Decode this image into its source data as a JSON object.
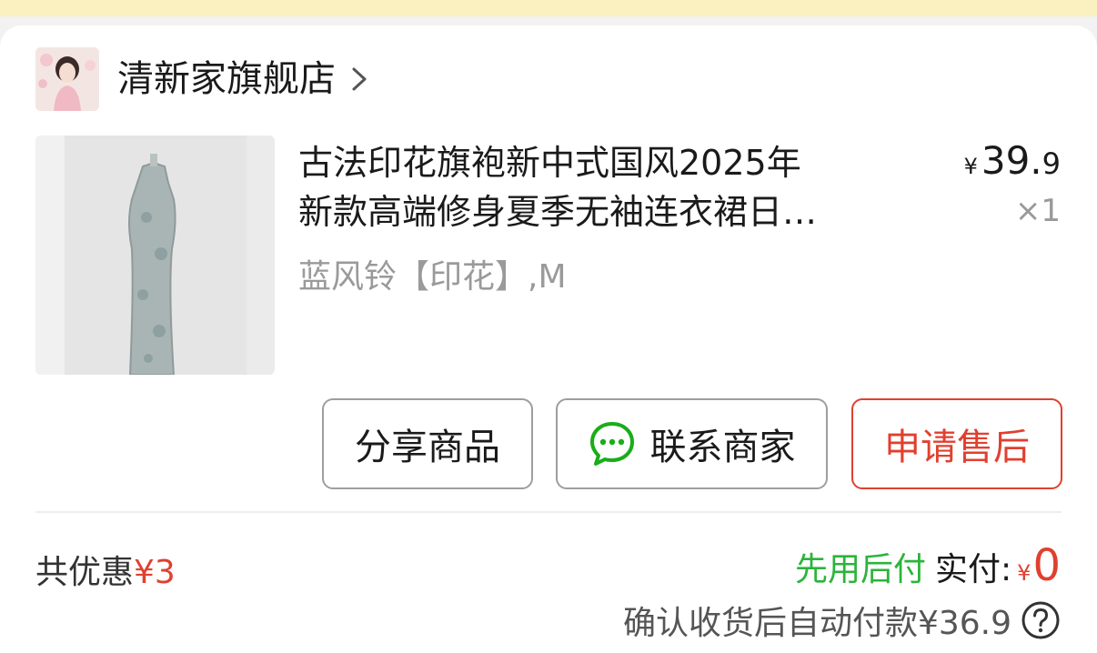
{
  "store": {
    "name": "清新家旗舰店",
    "avatar_icon": "store-avatar-portrait",
    "chevron_icon": "chevron-right-icon"
  },
  "product": {
    "title_line1": "古法印花旗袍新中式国风2025年",
    "title_line2": "新款高端修身夏季无袖连衣裙日…",
    "spec": "蓝风铃【印花】,M",
    "price_currency": "¥",
    "price_int": "39.",
    "price_dec": "9",
    "quantity": "×1",
    "image_icon": "qipao-dress-photo"
  },
  "actions": {
    "share": "分享商品",
    "contact": "联系商家",
    "after_sale": "申请售后",
    "contact_icon": "chat-bubble-icon"
  },
  "summary": {
    "discount_label": "共优惠",
    "discount_amount": "¥3",
    "pay_later": "先用后付",
    "paid_label": "实付:",
    "paid_currency": "¥",
    "paid_amount": "0",
    "auto_pay_text": "确认收货后自动付款¥36.9",
    "help_icon": "question-mark-icon"
  },
  "colors": {
    "banner": "#fbf0bf",
    "accent_red": "#e0402f",
    "accent_green": "#2bb43a",
    "chat_icon_green": "#1aad19"
  }
}
